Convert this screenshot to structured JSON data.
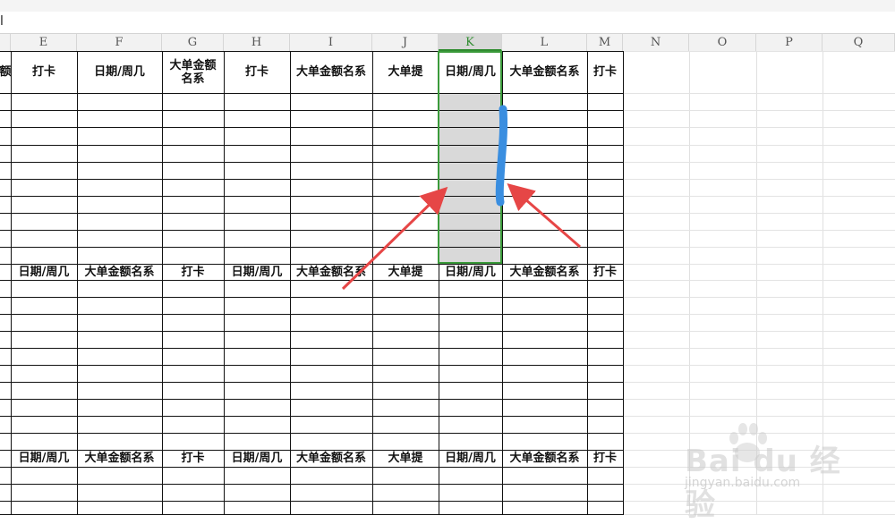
{
  "formula_bar": {
    "text": "l"
  },
  "columns": [
    {
      "letter": "",
      "selected": false
    },
    {
      "letter": "E",
      "selected": false
    },
    {
      "letter": "F",
      "selected": false
    },
    {
      "letter": "G",
      "selected": false
    },
    {
      "letter": "H",
      "selected": false
    },
    {
      "letter": "I",
      "selected": false
    },
    {
      "letter": "J",
      "selected": false
    },
    {
      "letter": "K",
      "selected": true
    },
    {
      "letter": "L",
      "selected": false
    },
    {
      "letter": "M",
      "selected": false
    },
    {
      "letter": "N",
      "selected": false
    },
    {
      "letter": "O",
      "selected": false
    },
    {
      "letter": "P",
      "selected": false
    },
    {
      "letter": "Q",
      "selected": false
    }
  ],
  "header_rows": [
    [
      "额",
      "打卡",
      "日期/周几",
      "大单金额名系",
      "打卡",
      "大单金额名系",
      "大单提",
      "日期/周几",
      "大单金额名系",
      "打卡"
    ],
    [
      "",
      "日期/周几",
      "大单金额名系",
      "打卡",
      "日期/周几",
      "大单金额名系",
      "大单提",
      "日期/周几",
      "大单金额名系",
      "打卡"
    ],
    [
      "",
      "日期/周几",
      "大单金额名系",
      "打卡",
      "日期/周几",
      "大单金额名系",
      "大单提",
      "日期/周几",
      "大单金额名系",
      "打卡"
    ]
  ],
  "annotation": {
    "highlight_color": "#d9d9d9",
    "selection_color": "#3a9a3a",
    "marker_color": "#3a8ee0",
    "arrow_color": "#e64646"
  },
  "watermark": {
    "brand": "Bai du 经验",
    "site": "jingyan.baidu.com"
  }
}
